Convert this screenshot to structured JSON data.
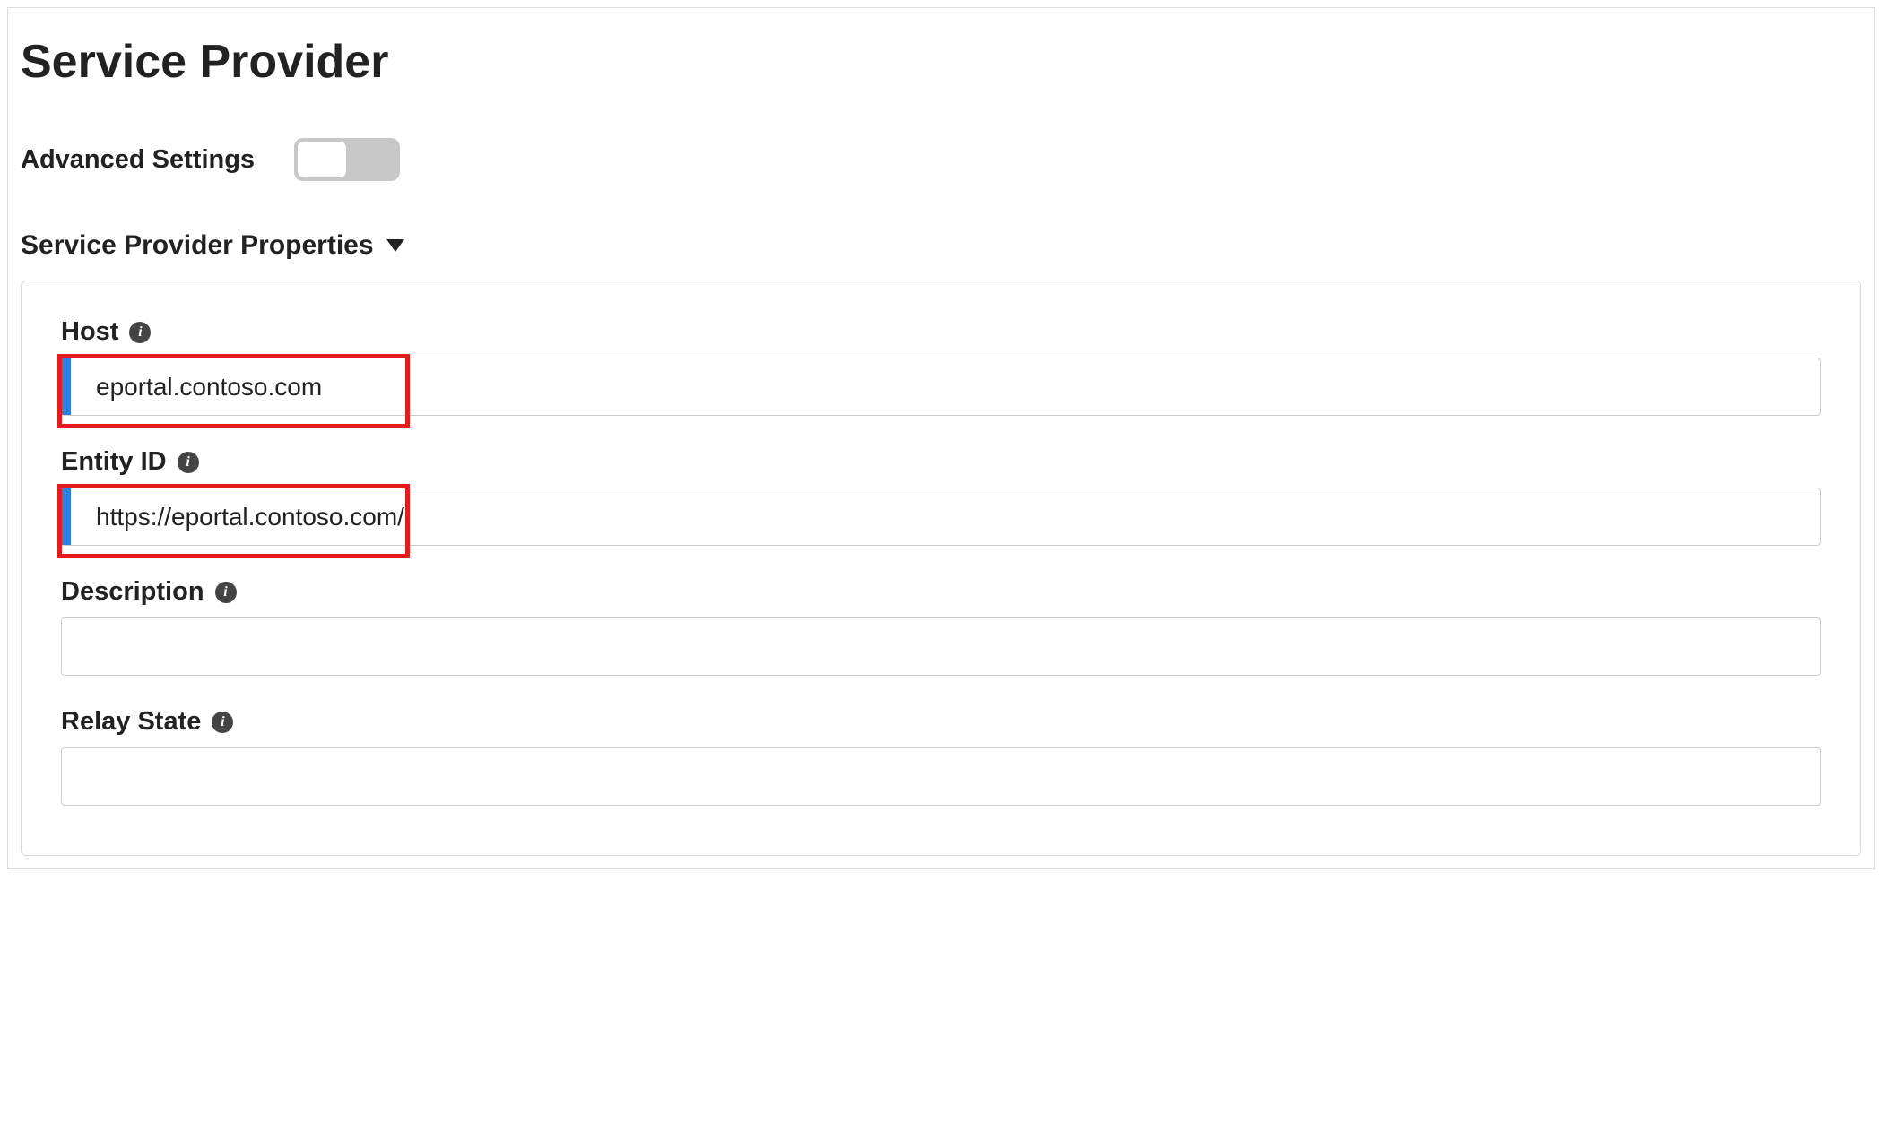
{
  "page": {
    "title": "Service Provider"
  },
  "advanced": {
    "label": "Advanced Settings",
    "enabled": false
  },
  "section": {
    "title": "Service Provider Properties"
  },
  "fields": {
    "host": {
      "label": "Host",
      "value": "eportal.contoso.com"
    },
    "entityId": {
      "label": "Entity ID",
      "value": "https://eportal.contoso.com/"
    },
    "description": {
      "label": "Description",
      "value": ""
    },
    "relayState": {
      "label": "Relay State",
      "value": ""
    }
  }
}
